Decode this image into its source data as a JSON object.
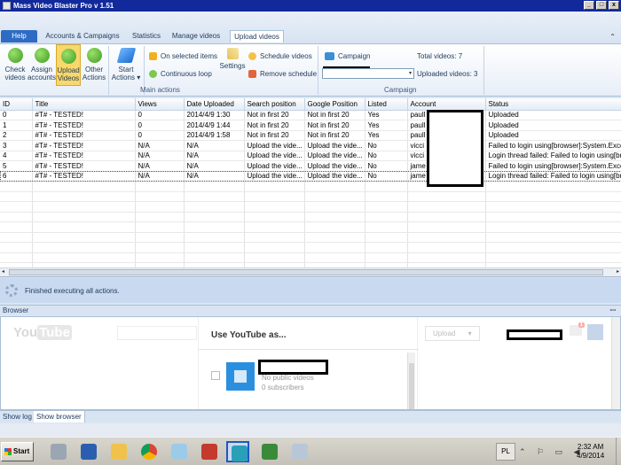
{
  "window": {
    "title": "Mass Video Blaster Pro    v 1.51",
    "controls": [
      "_",
      "□",
      "x"
    ]
  },
  "tabs": [
    {
      "label": "Help"
    },
    {
      "label": "Accounts & Campaigns"
    },
    {
      "label": "Statistics"
    },
    {
      "label": "Manage videos"
    },
    {
      "label": "Upload videos"
    }
  ],
  "active_tab": "Upload videos",
  "collapse_glyph": "⌃",
  "ribbon": {
    "main_actions": {
      "group_label": "Main actions",
      "check_videos": "Check\nvideos",
      "assign_accounts": "Assign\naccounts",
      "upload_videos": "Upload\nVideos",
      "other_actions": "Other\nActions",
      "start_actions": "Start\nActions ▾",
      "on_selected_items": "On selected items",
      "continuous_loop": "Continuous loop",
      "settings": "Settings",
      "schedule_videos": "Schedule videos",
      "remove_schedule": "Remove schedule"
    },
    "campaign": {
      "group_label": "Campaign",
      "campaign_label": "Campaign",
      "total_videos": "Total videos: 7",
      "uploaded_videos": "Uploaded videos: 3",
      "combo_arrow": "▾"
    }
  },
  "grid": {
    "columns": [
      "ID",
      "Title",
      "Views",
      "Date Uploaded",
      "Search position",
      "Google Position",
      "Listed",
      "Account",
      "Status"
    ],
    "rows": [
      [
        "0",
        "#T# - TESTED!",
        "0",
        "2014/4/9 1:30",
        "Not in first 20",
        "Not in first 20",
        "Yes",
        "paull",
        "Uploaded"
      ],
      [
        "1",
        "#T# - TESTED!",
        "0",
        "2014/4/9 1:44",
        "Not in first 20",
        "Not in first 20",
        "Yes",
        "paull",
        "Uploaded"
      ],
      [
        "2",
        "#T# - TESTED!",
        "0",
        "2014/4/9 1:58",
        "Not in first 20",
        "Not in first 20",
        "Yes",
        "paull",
        "Uploaded"
      ],
      [
        "3",
        "#T# - TESTED!",
        "N/A",
        "N/A",
        "Upload the vide...",
        "Upload the vide...",
        "No",
        "vicci",
        "Failed to login using[browser]:System.Exceptio"
      ],
      [
        "4",
        "#T# - TESTED!",
        "N/A",
        "N/A",
        "Upload the vide...",
        "Upload the vide...",
        "No",
        "vicci",
        "Login thread failed: Failed to login using[brow"
      ],
      [
        "5",
        "#T# - TESTED!",
        "N/A",
        "N/A",
        "Upload the vide...",
        "Upload the vide...",
        "No",
        "jame",
        "Failed to login using[browser]:System.Exceptio"
      ],
      [
        "6",
        "#T# - TESTED!",
        "N/A",
        "N/A",
        "Upload the vide...",
        "Upload the vide...",
        "No",
        "jame",
        "Login thread failed: Failed to login using[brow"
      ]
    ],
    "scroll_left": "◂",
    "scroll_right": "▸"
  },
  "status_message": "Finished executing all actions.",
  "browser": {
    "header": "Browser",
    "pin_glyph": "ꟷ",
    "youtube": {
      "logo_you": "You",
      "logo_tube": "Tube",
      "dialog_title": "Use YouTube as...",
      "no_videos": "No public videos",
      "subscribers": "0 subscribers",
      "upload_button": "Upload",
      "upload_arrow": "▾",
      "notif_count": "1"
    }
  },
  "bottom_tabs": [
    "Show log",
    "Show browser"
  ],
  "taskbar": {
    "start": "Start",
    "language": "PL",
    "tray_icons": "⌃ ⚐ ▭ ◀",
    "time": "2:32 AM",
    "date": "4/9/2014"
  },
  "colors": {
    "titlebar": "#11299a",
    "help_tab": "#2e6bc4",
    "active_button": "#f9d86b",
    "status_panel": "#c9d9ef"
  }
}
